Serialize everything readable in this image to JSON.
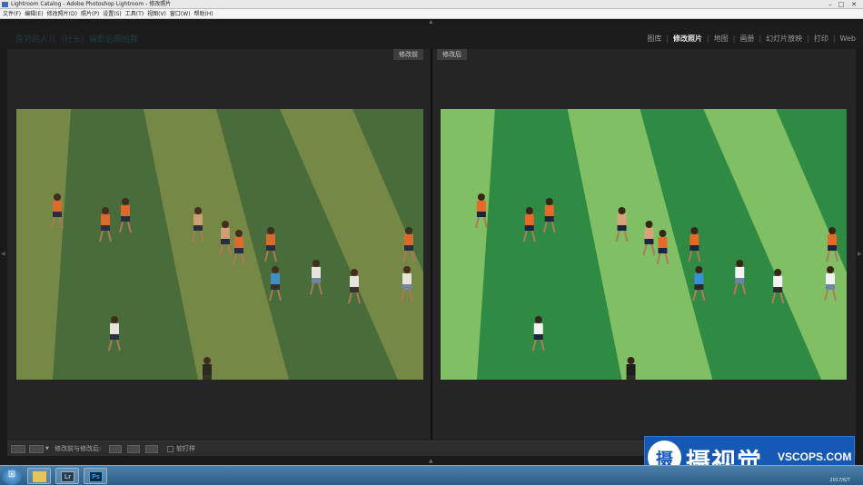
{
  "window": {
    "title": "Lightroom Catalog - Adobe Photoshop Lightroom - 修改照片",
    "minimize": "–",
    "maximize": "□",
    "close": "✕"
  },
  "menubar": {
    "items": [
      "文件(F)",
      "编辑(E)",
      "修改照片(D)",
      "照片(P)",
      "设置(S)",
      "工具(T)",
      "视图(V)",
      "窗口(W)",
      "帮助(H)"
    ]
  },
  "identity_plate": "原对的人儿（社长）摄影后期组群",
  "modules": {
    "items": [
      {
        "label": "图库",
        "active": false
      },
      {
        "label": "修改照片",
        "active": true
      },
      {
        "label": "地图",
        "active": false
      },
      {
        "label": "画册",
        "active": false
      },
      {
        "label": "幻灯片放映",
        "active": false
      },
      {
        "label": "打印",
        "active": false
      },
      {
        "label": "Web",
        "active": false
      }
    ],
    "separator": "|"
  },
  "compare": {
    "before_label": "修改前",
    "after_label": "修改后"
  },
  "toolbar": {
    "compare_label": "修改前与修改后:",
    "soft_proof_label": "软打样"
  },
  "watermark": {
    "logo_glyph": "摄",
    "chinese": "摄视觉",
    "english": "VSCOPS.COM"
  },
  "taskbar": {
    "start_glyph": "⊞",
    "explorer_glyph": "",
    "lr_glyph": "Lr",
    "ps_glyph": "Ps",
    "clock": "2017/6/7"
  },
  "colors": {
    "before_grass_light": "#7d8f4a",
    "before_grass_dark": "#3f6a39",
    "after_grass_light": "#8ec86a",
    "after_grass_dark": "#2f8a44",
    "jersey_orange": "#e6692a",
    "watermark_blue": "#1659b5"
  },
  "icons": {
    "arrow_up": "▲",
    "arrow_down": "▼",
    "arrow_left": "◀",
    "arrow_right": "▶"
  }
}
